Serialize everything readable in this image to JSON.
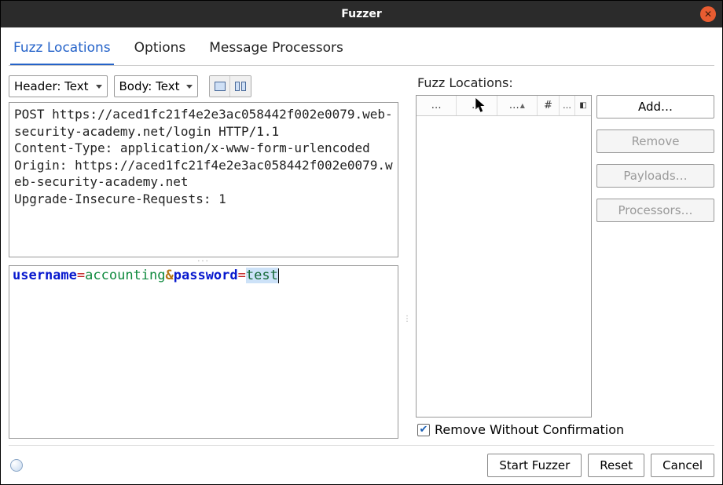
{
  "title": "Fuzzer",
  "tabs": [
    "Fuzz Locations",
    "Options",
    "Message Processors"
  ],
  "active_tab": 0,
  "header_select": "Header: Text",
  "body_select": "Body: Text",
  "request_header": "POST https://aced1fc21f4e2e3ac058442f002e0079.web-security-academy.net/login HTTP/1.1\nContent-Type: application/x-www-form-urlencoded\nOrigin: https://aced1fc21f4e2e3ac058442f002e0079.web-security-academy.net\nUpgrade-Insecure-Requests: 1",
  "request_body": {
    "tokens": [
      {
        "t": "key",
        "v": "username"
      },
      {
        "t": "eq",
        "v": "="
      },
      {
        "t": "val",
        "v": "accounting"
      },
      {
        "t": "amp",
        "v": "&"
      },
      {
        "t": "key",
        "v": "password"
      },
      {
        "t": "eq",
        "v": "="
      },
      {
        "t": "sel",
        "v": "test"
      }
    ]
  },
  "right_label": "Fuzz Locations:",
  "table_headers": [
    "…",
    "…",
    "…",
    "#",
    "…"
  ],
  "buttons": {
    "add": "Add…",
    "remove": "Remove",
    "payloads": "Payloads…",
    "processors": "Processors…"
  },
  "remove_confirm_label": "Remove Without Confirmation",
  "remove_confirm_checked": true,
  "bottom": {
    "start": "Start Fuzzer",
    "reset": "Reset",
    "cancel": "Cancel"
  }
}
